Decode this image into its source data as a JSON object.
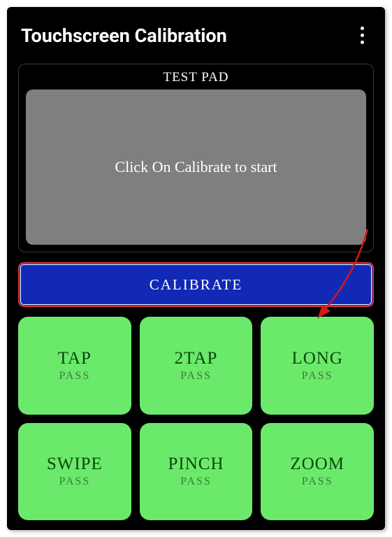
{
  "header": {
    "title": "Touchscreen Calibration"
  },
  "test_pad": {
    "label": "TEST PAD",
    "instruction": "Click On Calibrate to start"
  },
  "calibrate": {
    "label": "CALIBRATE"
  },
  "tiles": [
    {
      "title": "TAP",
      "status": "PASS"
    },
    {
      "title": "2TAP",
      "status": "PASS"
    },
    {
      "title": "LONG",
      "status": "PASS"
    },
    {
      "title": "SWIPE",
      "status": "PASS"
    },
    {
      "title": "PINCH",
      "status": "PASS"
    },
    {
      "title": "ZOOM",
      "status": "PASS"
    }
  ],
  "colors": {
    "tile_bg": "#6be96b",
    "calibrate_bg": "#1229b5",
    "highlight_border": "#d83a3a"
  }
}
